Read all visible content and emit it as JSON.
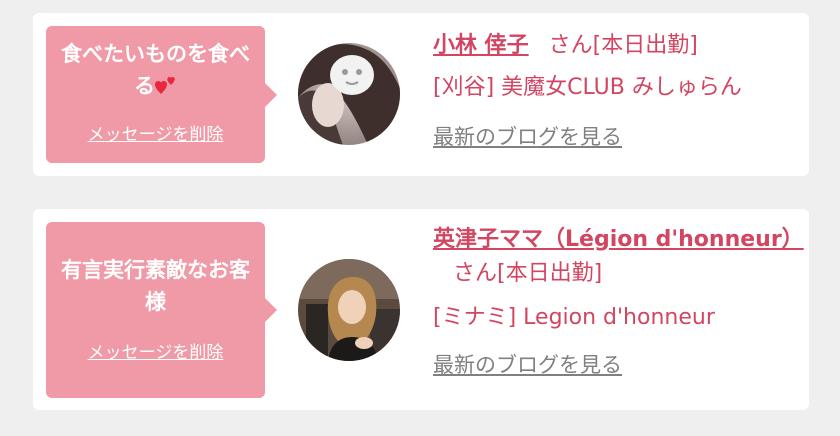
{
  "favorites": [
    {
      "message": "食べたいものを食べる",
      "delete_label": "メッセージを削除",
      "name": "小林 倖子",
      "honorific": "さん[本日出勤]",
      "shop": "[刈谷] 美魔女CLUB みしゅらん",
      "blog_label": "最新のブログを見る"
    },
    {
      "message": "有言実行素敵なお客様",
      "delete_label": "メッセージを削除",
      "name": "英津子ママ（Légion d'honneur）",
      "honorific": "さん[本日出勤]",
      "shop": "[ミナミ] Legion d'honneur",
      "blog_label": "最新のブログを見る"
    }
  ],
  "colors": {
    "bubble": "#ef9aa6",
    "accent_text": "#d24662",
    "muted_link": "#808080",
    "heart": "#e8283c"
  },
  "icons": [
    "two-hearts-icon",
    "avatar-photo"
  ]
}
